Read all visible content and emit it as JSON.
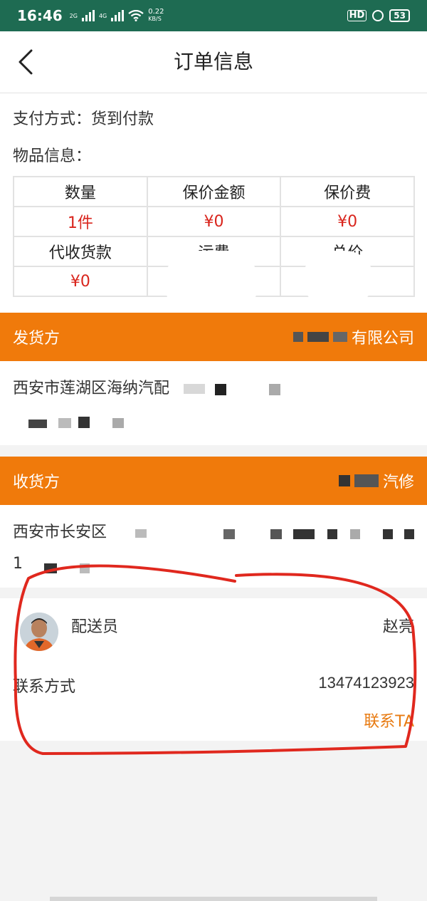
{
  "status_bar": {
    "time": "16:46",
    "network_labels": [
      "2G",
      "4G"
    ],
    "speed_value": "0.22",
    "speed_unit": "KB/S",
    "hd_label": "HD",
    "battery": "53"
  },
  "nav": {
    "title": "订单信息",
    "back_icon": "chevron-left-icon"
  },
  "order": {
    "payment_label": "支付方式：",
    "payment_value": "货到付款",
    "goods_label": "物品信息："
  },
  "goods_table": {
    "row1_headers": [
      "数量",
      "保价金额",
      "保价费"
    ],
    "row1_values": [
      "1件",
      "¥0",
      "¥0"
    ],
    "row2_headers": [
      "代收货款",
      "运费",
      "总价"
    ],
    "row2_values": [
      "¥0",
      "",
      ""
    ]
  },
  "sender": {
    "label": "发货方",
    "name_visible": "有限公司",
    "address_visible": "西安市莲湖区海纳汽配"
  },
  "receiver": {
    "label": "收货方",
    "name_visible": "汽修",
    "address_visible": "西安市长安区",
    "phone_visible": "1"
  },
  "courier": {
    "role_label": "配送员",
    "name": "赵亮",
    "contact_label": "联系方式",
    "phone": "13474123923",
    "contact_button": "联系TA"
  },
  "colors": {
    "status_bar": "#1e6b52",
    "orange_header": "#f07a0b",
    "red_value": "#d9251d",
    "link_orange": "#e87b12",
    "annotation_red": "#e0281e"
  }
}
